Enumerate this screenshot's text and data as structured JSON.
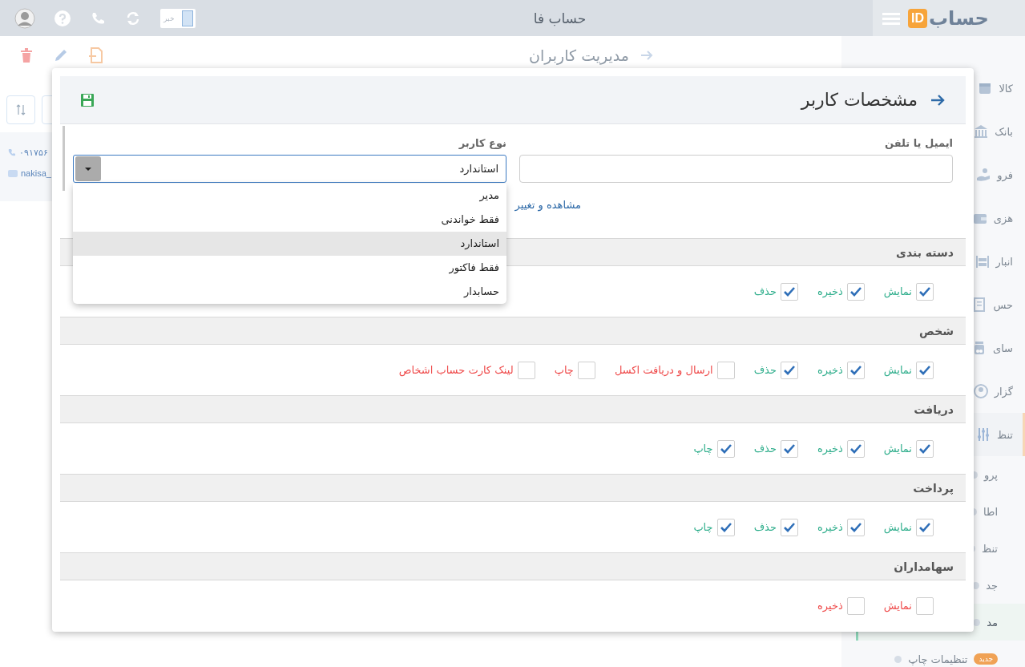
{
  "top_bar": {
    "logo": {
      "text": "حساب",
      "badge": "ID"
    },
    "title": "حساب فا",
    "news_toggle": "خبر"
  },
  "page": {
    "title": "مدیریت کاربران",
    "contact": {
      "phone": "۰۹۱۷۵۶",
      "email": "nakisa_"
    }
  },
  "sidebar": {
    "items": [
      {
        "label": "کالا",
        "selected": false
      },
      {
        "label": "بانک",
        "selected": false
      },
      {
        "label": "فرو",
        "selected": false
      },
      {
        "label": "هزی",
        "selected": false
      },
      {
        "label": "انبار",
        "selected": false
      },
      {
        "label": "حس",
        "selected": false
      },
      {
        "label": "سای",
        "selected": false
      },
      {
        "label": "گزار",
        "selected": false
      },
      {
        "label": "تنظ",
        "selected": true,
        "children": [
          {
            "label": "پرو",
            "selected": false
          },
          {
            "label": "اطا",
            "selected": false
          },
          {
            "label": "تنظ",
            "selected": false
          },
          {
            "label": "جد",
            "selected": false
          },
          {
            "label": "مد",
            "selected": true
          },
          {
            "label": "تنظیمات چاپ",
            "badge": "جدید",
            "selected": false
          }
        ]
      }
    ]
  },
  "dialog": {
    "title": "مشخصات کاربر",
    "email_field": {
      "label": "ایمیل یا تلفن"
    },
    "user_type": {
      "label": "نوع کاربر",
      "value": "استاندارد",
      "expanded": true,
      "options": [
        {
          "label": "مدیر",
          "selected": false
        },
        {
          "label": "فقط خواندنی",
          "selected": false
        },
        {
          "label": "استاندارد",
          "selected": true
        },
        {
          "label": "فقط فاکتور",
          "selected": false
        },
        {
          "label": "حسابدار",
          "selected": false
        }
      ]
    },
    "link": "مشاهده و تغییر",
    "sections": [
      {
        "title": "دسته بندی",
        "permissions": [
          {
            "label": "نمایش",
            "checked": true
          },
          {
            "label": "ذخیره",
            "checked": true
          },
          {
            "label": "حذف",
            "checked": true
          }
        ]
      },
      {
        "title": "شخص",
        "permissions": [
          {
            "label": "نمایش",
            "checked": true
          },
          {
            "label": "ذخیره",
            "checked": true
          },
          {
            "label": "حذف",
            "checked": true
          },
          {
            "label": "ارسال و دریافت اکسل",
            "checked": false
          },
          {
            "label": "چاپ",
            "checked": false
          },
          {
            "label": "لینک کارت حساب اشخاص",
            "checked": false
          }
        ]
      },
      {
        "title": "دریافت",
        "permissions": [
          {
            "label": "نمایش",
            "checked": true
          },
          {
            "label": "ذخیره",
            "checked": true
          },
          {
            "label": "حذف",
            "checked": true
          },
          {
            "label": "چاپ",
            "checked": true
          }
        ]
      },
      {
        "title": "پرداخت",
        "permissions": [
          {
            "label": "نمایش",
            "checked": true
          },
          {
            "label": "ذخیره",
            "checked": true
          },
          {
            "label": "حذف",
            "checked": true
          },
          {
            "label": "چاپ",
            "checked": true
          }
        ]
      },
      {
        "title": "سهامداران",
        "permissions": [
          {
            "label": "نمایش",
            "checked": false
          },
          {
            "label": "ذخیره",
            "checked": false
          }
        ]
      }
    ]
  }
}
